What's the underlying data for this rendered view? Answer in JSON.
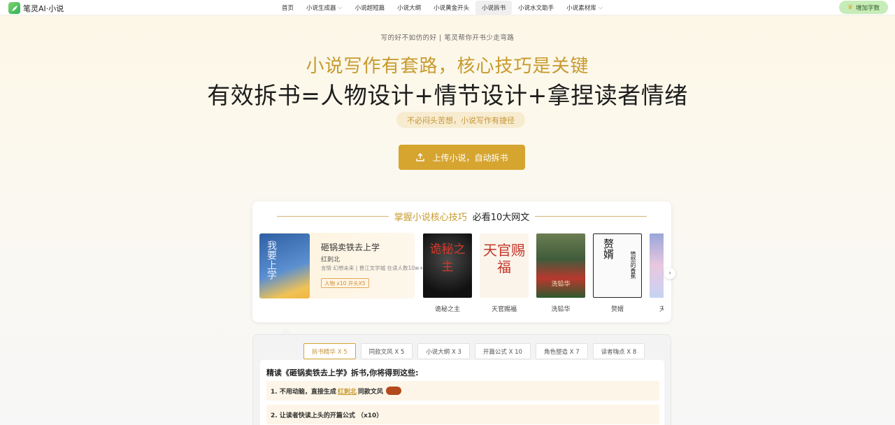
{
  "brand": {
    "name": "笔灵AI·小说"
  },
  "nav": {
    "items": [
      {
        "label": "首页",
        "has_dropdown": false,
        "active": false
      },
      {
        "label": "小说生成器",
        "has_dropdown": true,
        "active": false
      },
      {
        "label": "小说超短篇",
        "has_dropdown": false,
        "active": false
      },
      {
        "label": "小说大纲",
        "has_dropdown": false,
        "active": false
      },
      {
        "label": "小说黄金开头",
        "has_dropdown": false,
        "active": false
      },
      {
        "label": "小说拆书",
        "has_dropdown": false,
        "active": true
      },
      {
        "label": "小说水文助手",
        "has_dropdown": false,
        "active": false
      },
      {
        "label": "小说素材库",
        "has_dropdown": true,
        "active": false
      }
    ],
    "cta_label": "增加字数",
    "cta_icon": "crown-icon"
  },
  "hero": {
    "tagline": "写的好不如仿的好 | 笔灵帮你开书少走弯路",
    "headline1": "小说写作有套路，核心技巧是关键",
    "headline2": "有效拆书=人物设计+情节设计+拿捏读者情绪",
    "pill": "不必闷头苦想，小说写作有捷径",
    "upload_label": "上传小说，自动拆书",
    "upload_icon": "upload-icon"
  },
  "books_section": {
    "title_gold": "掌握小说核心技巧",
    "title_dark": "必看10大网文",
    "featured": {
      "title": "砸锅卖铁去上学",
      "author": "红刺北",
      "meta": "言情 幻想未来 | 晋江文学城 在读人数10w+",
      "tag": "人物 x10 开头X5",
      "cover_text": "我要上学"
    },
    "books": [
      {
        "name": "诡秘之主",
        "cover_text": "诡秘之主"
      },
      {
        "name": "天官赐福",
        "cover_text": "天官赐福"
      },
      {
        "name": "洗铅华",
        "cover_text": "洗铅华"
      },
      {
        "name": "赘婿",
        "cover_text": "赘婿",
        "cover_sub": "愤怒的香蕉"
      },
      {
        "name": "天",
        "cover_text": ""
      }
    ],
    "next_icon": "chevron-right-icon"
  },
  "analysis": {
    "tabs": [
      {
        "label": "拆书精华 X 5",
        "active": true
      },
      {
        "label": "同款文风 X 5",
        "active": false
      },
      {
        "label": "小说大纲 X 3",
        "active": false
      },
      {
        "label": "开篇公式 X 10",
        "active": false
      },
      {
        "label": "角色塑造 X 7",
        "active": false
      },
      {
        "label": "读者嗨点 X 8",
        "active": false
      }
    ],
    "panel_title": "精读《砸锅卖铁去上学》拆书,你将得到这些:",
    "item1_prefix": "1. 不用动脑，直接生成",
    "item1_link": "红刺北",
    "item1_suffix": "同款文风",
    "item2": "2. 让读者快读上头的开篇公式 （x10）"
  }
}
